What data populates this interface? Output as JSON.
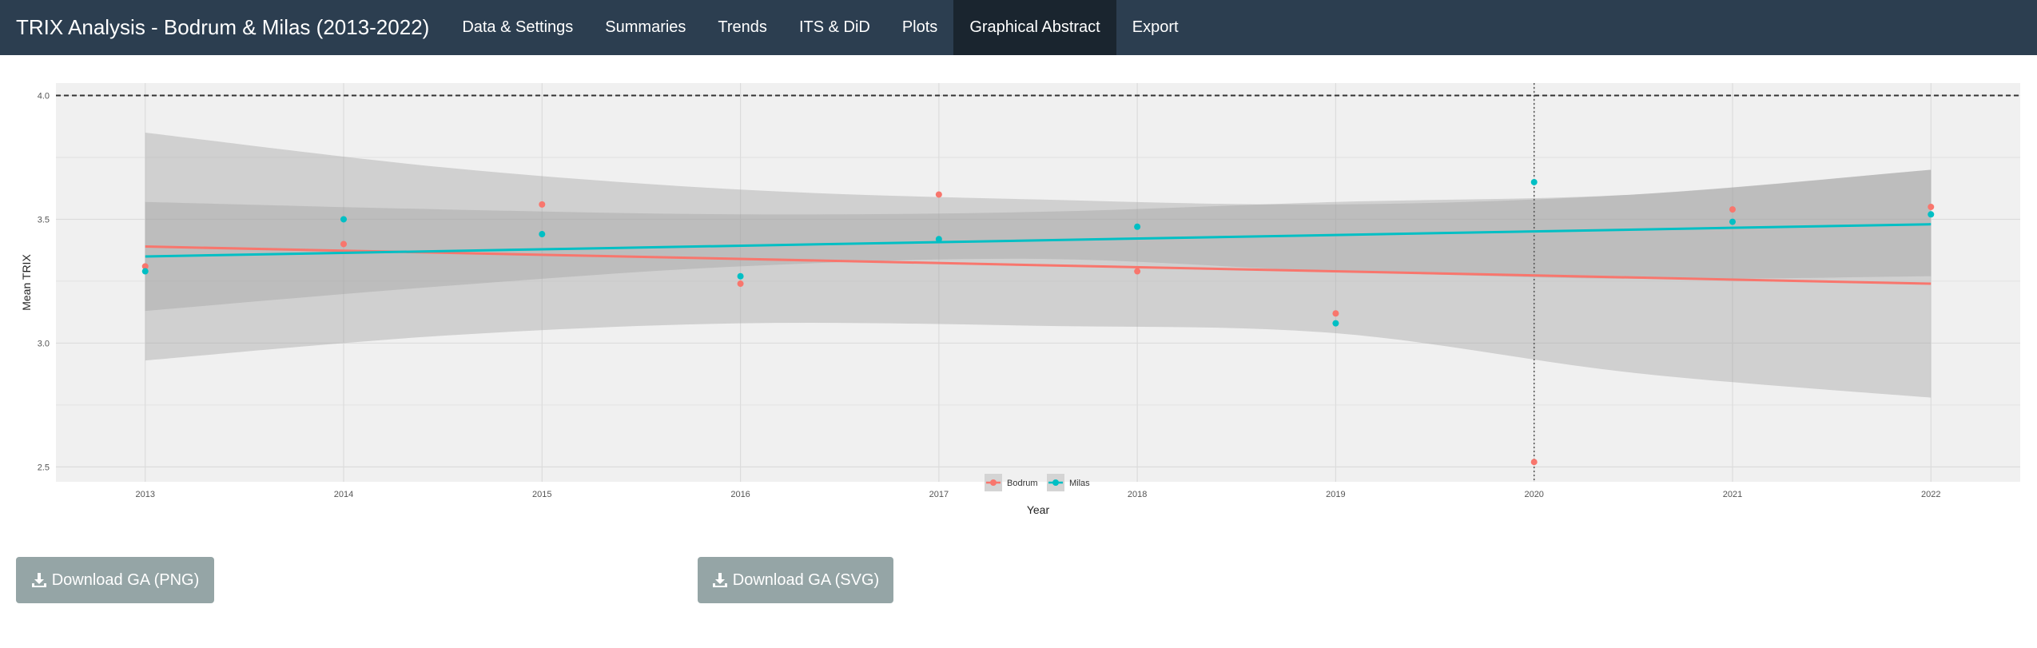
{
  "navbar": {
    "brand": "TRIX Analysis - Bodrum & Milas (2013-2022)",
    "tabs": [
      {
        "label": "Data & Settings"
      },
      {
        "label": "Summaries"
      },
      {
        "label": "Trends"
      },
      {
        "label": "ITS & DiD"
      },
      {
        "label": "Plots"
      },
      {
        "label": "Graphical Abstract",
        "active": true
      },
      {
        "label": "Export"
      }
    ]
  },
  "chart_data": {
    "type": "scatter",
    "title": "",
    "xlabel": "Year",
    "ylabel": "Mean TRIX",
    "x": [
      2013,
      2014,
      2015,
      2016,
      2017,
      2018,
      2019,
      2020,
      2021,
      2022
    ],
    "xlim": [
      2012.55,
      2022.45
    ],
    "ylim": [
      2.44,
      4.05
    ],
    "x_ticks": [
      "2013",
      "2014",
      "2015",
      "2016",
      "2017",
      "2018",
      "2019",
      "2020",
      "2021",
      "2022"
    ],
    "y_ticks": [
      "2.5",
      "3.0",
      "3.5",
      "4.0"
    ],
    "grid": true,
    "legend_position": "bottom",
    "threshold_line": {
      "axis": "y",
      "value": 4.0,
      "style": "dashed"
    },
    "intervention_line": {
      "axis": "x",
      "value": 2020,
      "style": "dotted"
    },
    "series": [
      {
        "name": "Bodrum",
        "color": "#f8766d",
        "values": [
          3.31,
          3.4,
          3.56,
          3.24,
          3.6,
          3.29,
          3.12,
          2.52,
          3.54,
          3.55
        ],
        "trend": {
          "start": 3.39,
          "end": 3.24
        },
        "ci": {
          "lower": [
            2.93,
            3.03,
            3.08,
            3.07,
            3.04,
            2.88,
            2.78
          ],
          "upper": [
            3.85,
            3.71,
            3.62,
            3.58,
            3.56,
            3.6,
            3.7
          ]
        }
      },
      {
        "name": "Milas",
        "color": "#00bfc4",
        "values": [
          3.29,
          3.5,
          3.44,
          3.27,
          3.42,
          3.47,
          3.08,
          3.65,
          3.49,
          3.52
        ],
        "trend": {
          "start": 3.35,
          "end": 3.48
        },
        "ci": {
          "lower": [
            3.13,
            3.23,
            3.31,
            3.34,
            3.29,
            3.26,
            3.27
          ],
          "upper": [
            3.57,
            3.54,
            3.52,
            3.53,
            3.57,
            3.6,
            3.7
          ]
        }
      }
    ],
    "panel_background": "#f0f0f0",
    "ribbon_color": "#a0a0a0"
  },
  "buttons": {
    "png_label": "Download GA (PNG)",
    "svg_label": "Download GA (SVG)"
  }
}
